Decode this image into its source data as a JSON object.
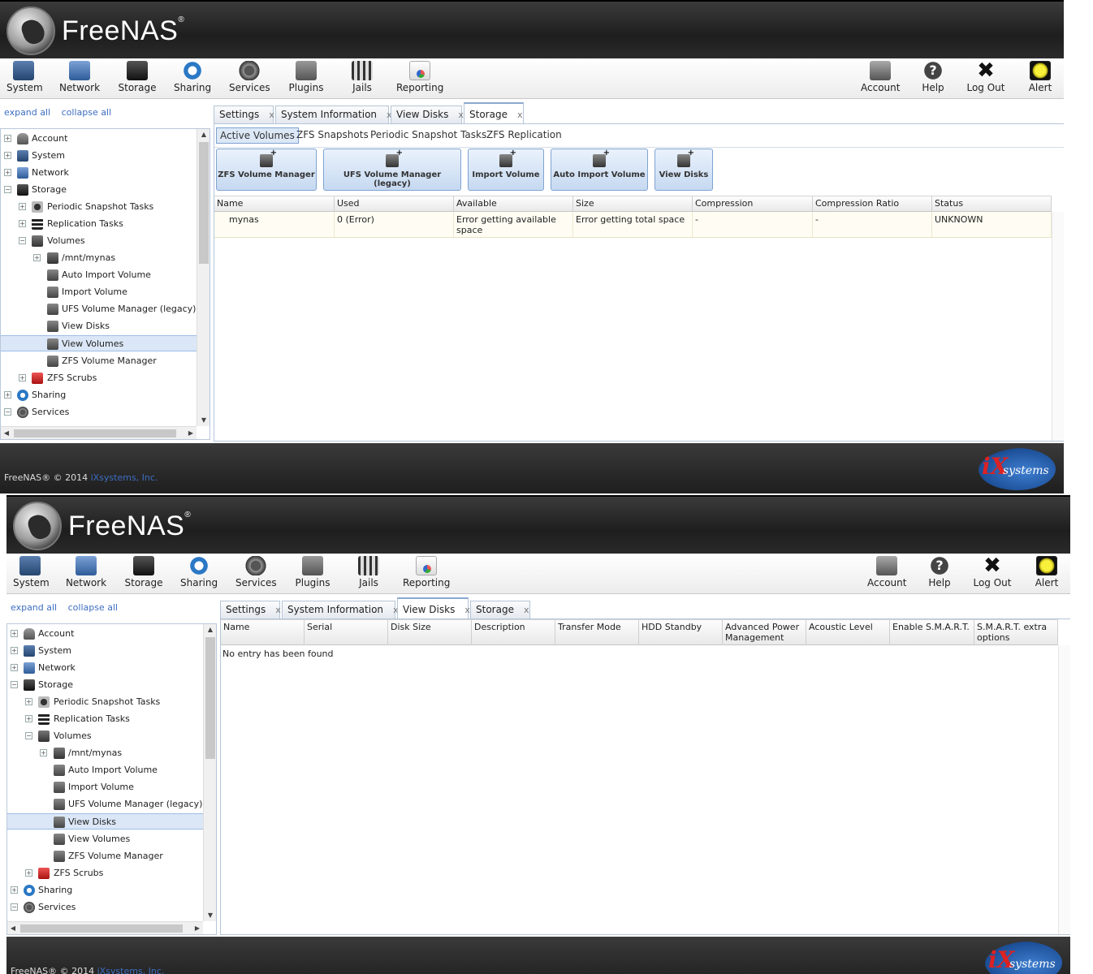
{
  "brand": {
    "name": "FreeNAS",
    "mark": "®"
  },
  "toolbar": {
    "left": [
      {
        "label": "System",
        "icon": "system-icon"
      },
      {
        "label": "Network",
        "icon": "network-icon"
      },
      {
        "label": "Storage",
        "icon": "storage-icon"
      },
      {
        "label": "Sharing",
        "icon": "sharing-icon"
      },
      {
        "label": "Services",
        "icon": "services-icon"
      },
      {
        "label": "Plugins",
        "icon": "plugins-icon"
      },
      {
        "label": "Jails",
        "icon": "jails-icon"
      },
      {
        "label": "Reporting",
        "icon": "reporting-icon"
      }
    ],
    "right": [
      {
        "label": "Account",
        "icon": "account-icon"
      },
      {
        "label": "Help",
        "icon": "help-icon"
      },
      {
        "label": "Log Out",
        "icon": "logout-icon"
      },
      {
        "label": "Alert",
        "icon": "alert-icon"
      }
    ]
  },
  "tree_links": {
    "expand": "expand all",
    "collapse": "collapse all"
  },
  "tree": {
    "items": [
      {
        "label": "Account",
        "toggle": "+"
      },
      {
        "label": "System",
        "toggle": "+"
      },
      {
        "label": "Network",
        "toggle": "+"
      },
      {
        "label": "Storage",
        "toggle": "−"
      },
      {
        "label": "Periodic Snapshot Tasks",
        "toggle": "+"
      },
      {
        "label": "Replication Tasks",
        "toggle": "+"
      },
      {
        "label": "Volumes",
        "toggle": "−"
      },
      {
        "label": "/mnt/mynas",
        "toggle": "+"
      },
      {
        "label": "Auto Import Volume"
      },
      {
        "label": "Import Volume"
      },
      {
        "label": "UFS Volume Manager (legacy)"
      },
      {
        "label": "View Disks"
      },
      {
        "label": "View Volumes"
      },
      {
        "label": "ZFS Volume Manager"
      },
      {
        "label": "ZFS Scrubs",
        "toggle": "+"
      },
      {
        "label": "Sharing",
        "toggle": "+"
      },
      {
        "label": "Services",
        "toggle": "−"
      }
    ]
  },
  "frame1": {
    "tabs": [
      {
        "label": "Settings"
      },
      {
        "label": "System Information"
      },
      {
        "label": "View Disks"
      },
      {
        "label": "Storage",
        "active": true
      }
    ],
    "subtabs": [
      "Active Volumes",
      "ZFS Snapshots",
      "Periodic Snapshot Tasks",
      "ZFS Replication"
    ],
    "buttons": [
      "ZFS Volume Manager",
      "UFS Volume Manager (legacy)",
      "Import Volume",
      "Auto Import Volume",
      "View Disks"
    ],
    "columns": [
      "Name",
      "Used",
      "Available",
      "Size",
      "Compression",
      "Compression Ratio",
      "Status"
    ],
    "row": [
      "mynas",
      "0 (Error)",
      "Error getting available space",
      "Error getting total space",
      "-",
      "-",
      "UNKNOWN"
    ]
  },
  "frame2": {
    "tabs": [
      {
        "label": "Settings"
      },
      {
        "label": "System Information"
      },
      {
        "label": "View Disks",
        "active": true
      },
      {
        "label": "Storage"
      }
    ],
    "columns": [
      "Name",
      "Serial",
      "Disk Size",
      "Description",
      "Transfer Mode",
      "HDD Standby",
      "Advanced Power Management",
      "Acoustic Level",
      "Enable S.M.A.R.T.",
      "S.M.A.R.T. extra options"
    ],
    "empty": "No entry has been found"
  },
  "footer": {
    "copyright": "FreeNAS® © 2014",
    "company": "iXsystems, Inc.",
    "logo_ix": "iX",
    "logo_systems": "systems"
  },
  "close_glyph": "x"
}
